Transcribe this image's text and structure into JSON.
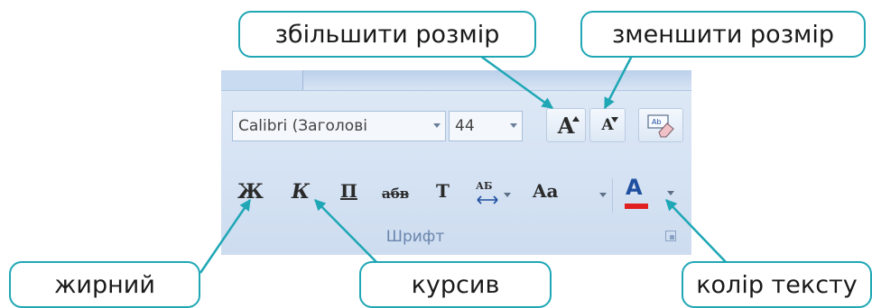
{
  "callouts": {
    "grow": "збільшити розмір",
    "shrink": "зменшити розмір",
    "bold": "жирний",
    "italic": "курсив",
    "color": "колір тексту"
  },
  "ribbon": {
    "font_name": "Calibri (Заголові",
    "font_size": "44",
    "grow_glyph": "A",
    "shrink_glyph": "A",
    "bold_glyph": "Ж",
    "italic_glyph": "К",
    "underline_glyph": "П",
    "strike_glyph": "абв",
    "t_glyph": "T",
    "ab_glyph": "АБ",
    "case_glyph": "Aa",
    "color_glyph": "A",
    "group_label": "Шрифт"
  },
  "colors": {
    "accent": "#1fa7b5",
    "font_color_bar": "#e02020"
  }
}
